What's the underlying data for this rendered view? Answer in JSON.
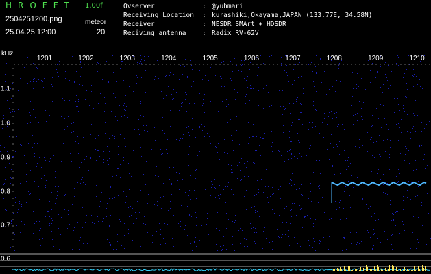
{
  "header": {
    "app_name": "HROFFT",
    "version": "1.00f",
    "file_name": "2504251200.png",
    "timestamp": "25.04.25 12:00",
    "mode": "meteor",
    "count": "20",
    "info": [
      {
        "key": "Ovserver",
        "value": "@yuhmari"
      },
      {
        "key": "Receiving Location",
        "value": "kurashiki,Okayama,JAPAN (133.77E, 34.58N)"
      },
      {
        "key": "Receiver",
        "value": "NESDR SMArt + HDSDR"
      },
      {
        "key": "Reciving antenna",
        "value": "Radix RV-62V"
      }
    ]
  },
  "spectrogram": {
    "y_unit": "kHz",
    "x_ticks": [
      "1201",
      "1202",
      "1203",
      "1204",
      "1205",
      "1206",
      "1207",
      "1208",
      "1209",
      "1210"
    ],
    "y_ticks": [
      "1.1",
      "1.0",
      "0.9",
      "0.8",
      "0.7",
      "0.6"
    ],
    "colors": {
      "background": "#000000",
      "noise": "#1a1fb0",
      "signal": "#4fb8ff",
      "baseline": "#37d7ff",
      "text": "#ffffff",
      "title": "#4fe04f"
    }
  }
}
